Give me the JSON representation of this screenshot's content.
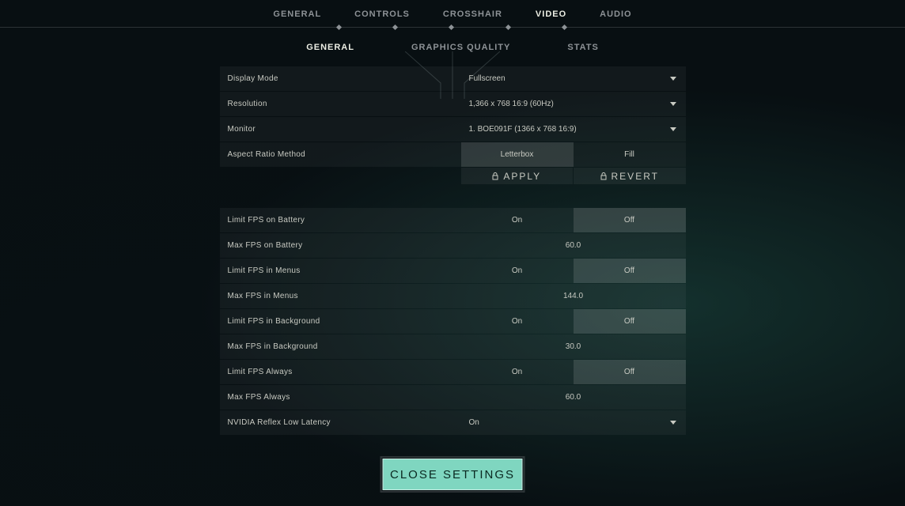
{
  "topTabs": {
    "general": "GENERAL",
    "controls": "CONTROLS",
    "crosshair": "CROSSHAIR",
    "video": "VIDEO",
    "audio": "AUDIO"
  },
  "subTabs": {
    "general": "GENERAL",
    "graphics": "GRAPHICS QUALITY",
    "stats": "STATS"
  },
  "labels": {
    "displayMode": "Display Mode",
    "resolution": "Resolution",
    "monitor": "Monitor",
    "aspectRatio": "Aspect Ratio Method",
    "letterbox": "Letterbox",
    "fill": "Fill",
    "apply": "APPLY",
    "revert": "REVERT",
    "on": "On",
    "off": "Off",
    "limitFpsBattery": "Limit FPS on Battery",
    "maxFpsBattery": "Max FPS on Battery",
    "limitFpsMenus": "Limit FPS in Menus",
    "maxFpsMenus": "Max FPS in Menus",
    "limitFpsBg": "Limit FPS in Background",
    "maxFpsBg": "Max FPS in Background",
    "limitFpsAlways": "Limit FPS Always",
    "maxFpsAlways": "Max FPS Always",
    "nvidiaReflex": "NVIDIA Reflex Low Latency",
    "close": "CLOSE SETTINGS"
  },
  "values": {
    "displayMode": "Fullscreen",
    "resolution": "1,366 x 768 16:9 (60Hz)",
    "monitor": "1. BOE091F (1366 x  768 16:9)",
    "maxFpsBattery": "60.0",
    "maxFpsMenus": "144.0",
    "maxFpsBg": "30.0",
    "maxFpsAlways": "60.0",
    "nvidiaReflex": "On"
  }
}
